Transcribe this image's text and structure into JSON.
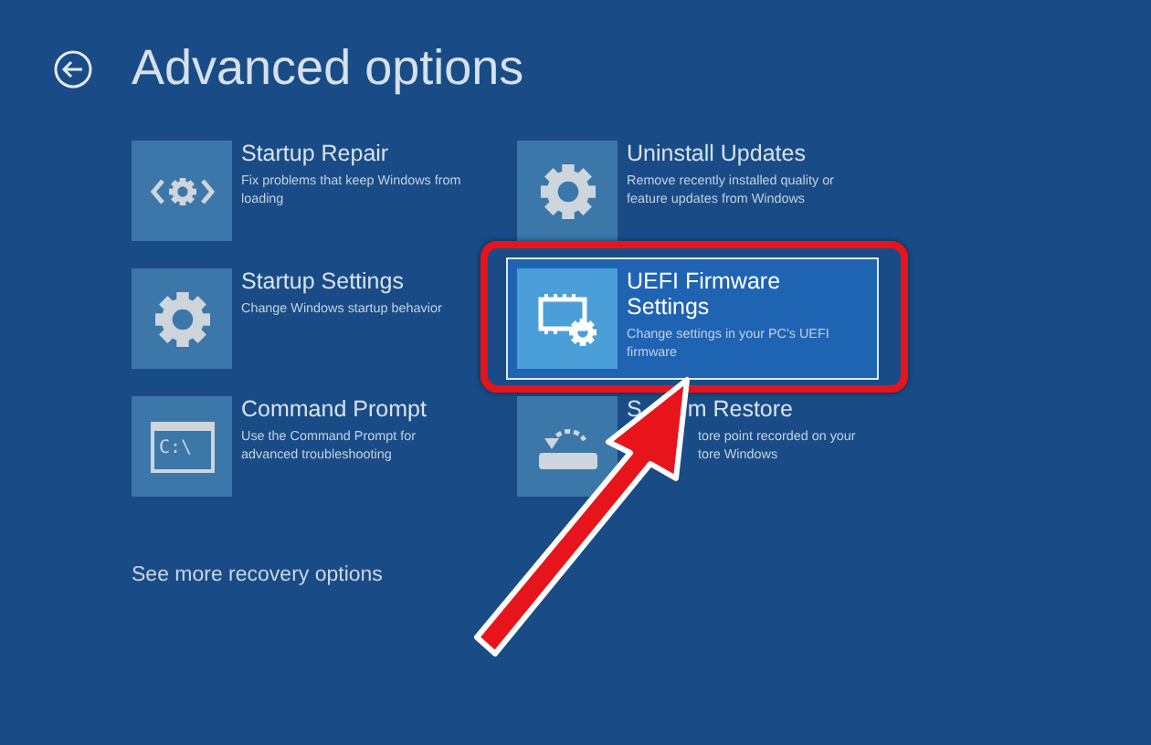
{
  "header": {
    "title": "Advanced options"
  },
  "tiles": [
    {
      "kind": "repair",
      "title": "Startup Repair",
      "description": "Fix problems that keep Windows from loading",
      "selected": false,
      "highlighted": false
    },
    {
      "kind": "update",
      "title": "Uninstall Updates",
      "description": "Remove recently installed quality or feature updates from Windows",
      "selected": false,
      "highlighted": false
    },
    {
      "kind": "settings",
      "title": "Startup Settings",
      "description": "Change Windows startup behavior",
      "selected": false,
      "highlighted": false
    },
    {
      "kind": "firmware",
      "title": "UEFI Firmware Settings",
      "description": "Change settings in your PC's UEFI firmware",
      "selected": true,
      "highlighted": true
    },
    {
      "kind": "prompt",
      "title": "Command Prompt",
      "description": "Use the Command Prompt for advanced troubleshooting",
      "selected": false,
      "highlighted": false,
      "icon_text": "C:\\"
    },
    {
      "kind": "restore",
      "title_parts": [
        "S",
        "m Restore"
      ],
      "description": "tore point recorded on your tore Windows",
      "selected": false,
      "highlighted": false
    }
  ],
  "more_link": "See more recovery options"
}
